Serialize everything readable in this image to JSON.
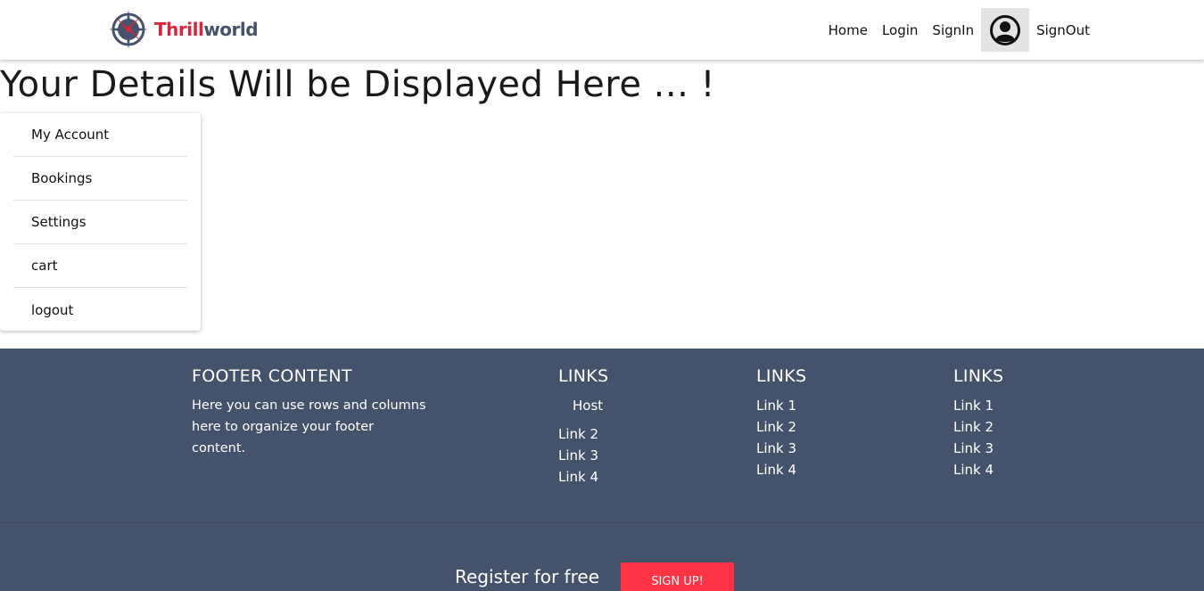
{
  "brand": {
    "part1": "Thrill",
    "part2": "world"
  },
  "nav": {
    "home": "Home",
    "login": "Login",
    "signin": "SignIn",
    "signout": "SignOut"
  },
  "main": {
    "title": "Your Details Will be Displayed Here ... !"
  },
  "side_menu": {
    "items": [
      {
        "label": "My Account"
      },
      {
        "label": "Bookings"
      },
      {
        "label": "Settings"
      },
      {
        "label": "cart"
      },
      {
        "label": "logout"
      }
    ]
  },
  "footer": {
    "content": {
      "heading": "FOOTER CONTENT",
      "text": "Here you can use rows and columns here to organize your footer content."
    },
    "columns": [
      {
        "heading": "LINKS",
        "links": [
          "Host",
          "Link 2",
          "Link 3",
          "Link 4"
        ]
      },
      {
        "heading": "LINKS",
        "links": [
          "Link 1",
          "Link 2",
          "Link 3",
          "Link 4"
        ]
      },
      {
        "heading": "LINKS",
        "links": [
          "Link 1",
          "Link 2",
          "Link 3",
          "Link 4"
        ]
      }
    ],
    "register_label": "Register for free",
    "signup_label": "SIGN UP!"
  },
  "colors": {
    "footer_bg": "#45526c",
    "brand_red": "#d7263d",
    "brand_navy": "#45536d",
    "signup_bg": "#ff3344"
  }
}
